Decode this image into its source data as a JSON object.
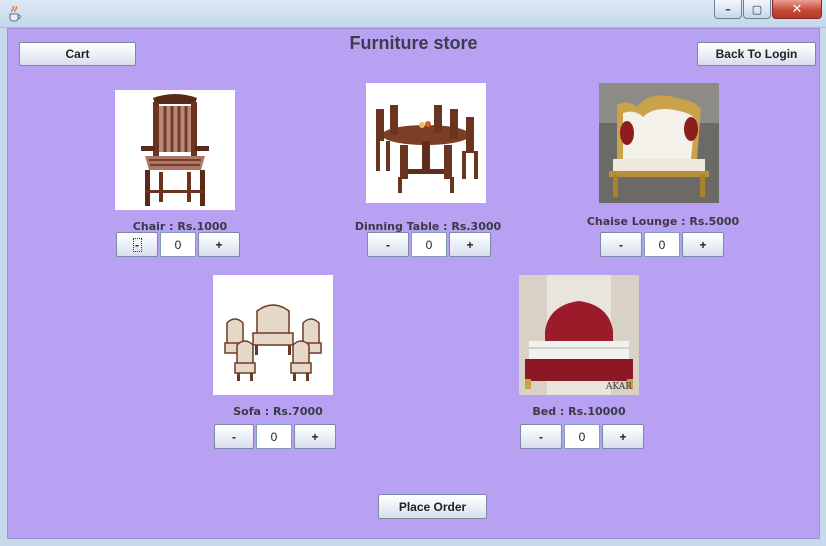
{
  "window": {
    "icon": "java-coffee-icon",
    "controls": {
      "minimize_icon": "minimize-icon",
      "maximize_icon": "maximize-icon",
      "close_icon": "close-icon",
      "minimize": "–",
      "maximize": "▢",
      "close": "✕"
    }
  },
  "header": {
    "title": "Furniture store",
    "cart_label": "Cart",
    "back_label": "Back To Login"
  },
  "products": [
    {
      "caption": "Chair : Rs.1000",
      "qty": "0",
      "minus": "-",
      "plus": "+",
      "image": "chair-image"
    },
    {
      "caption": "Dinning Table : Rs.3000",
      "qty": "0",
      "minus": "-",
      "plus": "+",
      "image": "dining-table-image"
    },
    {
      "caption": "Chaise Lounge : Rs.5000",
      "qty": "0",
      "minus": "-",
      "plus": "+",
      "image": "chaise-lounge-image"
    },
    {
      "caption": "Sofa : Rs.7000",
      "qty": "0",
      "minus": "-",
      "plus": "+",
      "image": "sofa-image"
    },
    {
      "caption": "Bed : Rs.10000",
      "qty": "0",
      "minus": "-",
      "plus": "+",
      "image": "bed-image",
      "watermark": "AKAR"
    }
  ],
  "footer": {
    "place_order_label": "Place Order"
  },
  "colors": {
    "panel_bg": "#b8a1f3",
    "titlebar": "#c9d9ec"
  }
}
